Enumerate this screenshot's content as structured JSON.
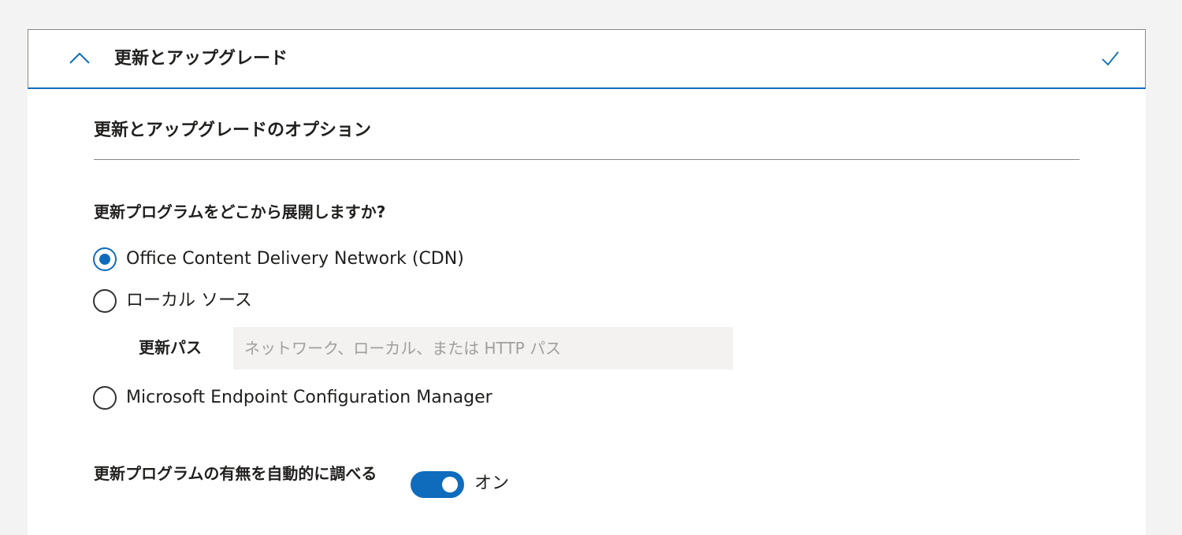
{
  "accordion": {
    "title": "更新とアップグレード",
    "expanded": true,
    "completed": true
  },
  "section": {
    "title": "更新とアップグレードのオプション"
  },
  "update_source": {
    "question": "更新プログラムをどこから展開しますか?",
    "options": [
      {
        "label": "Office Content Delivery Network (CDN)",
        "selected": true
      },
      {
        "label": "ローカル ソース",
        "selected": false
      },
      {
        "label": "Microsoft Endpoint Configuration Manager",
        "selected": false
      }
    ],
    "update_path": {
      "label": "更新パス",
      "value": "",
      "placeholder": "ネットワーク、ローカル、または HTTP パス"
    }
  },
  "auto_check": {
    "label": "更新プログラムの有無を自動的に調べる",
    "enabled": true,
    "state_text": "オン"
  },
  "colors": {
    "accent": "#0f6cbd",
    "background": "#f3f3f3",
    "input_background": "#f3f2f1"
  },
  "icons": {
    "header_toggle": "chevron-up-icon",
    "status": "check-icon"
  }
}
